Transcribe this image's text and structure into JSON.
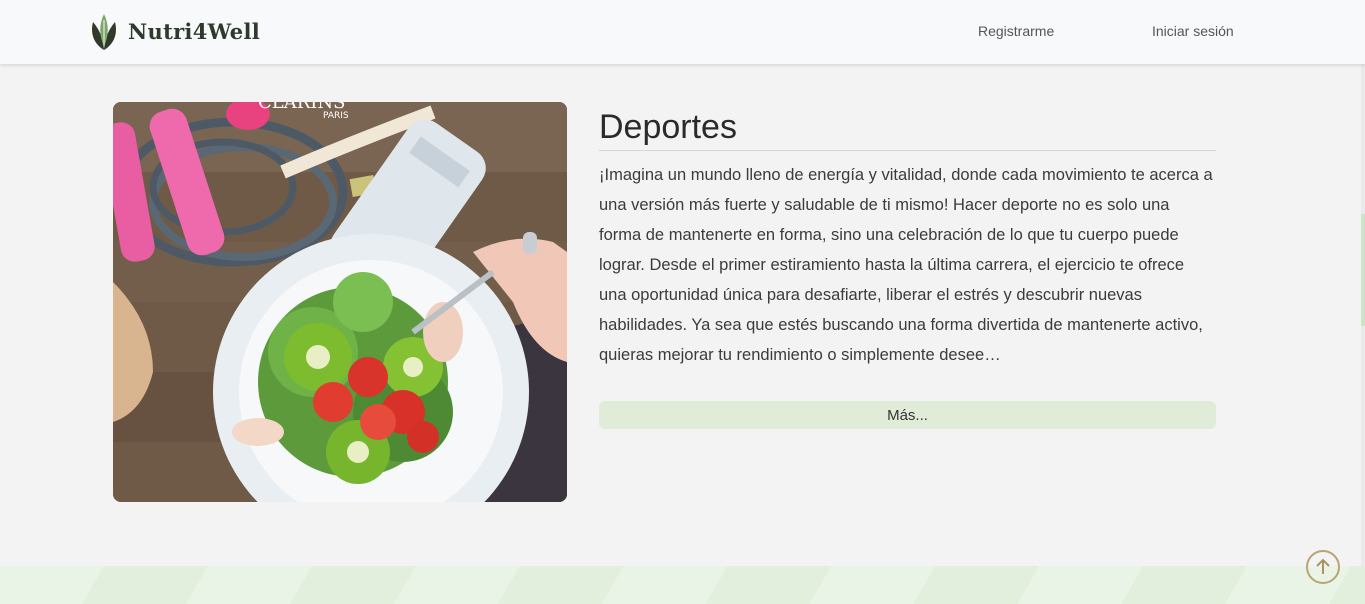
{
  "header": {
    "brand": "Nutri4Well",
    "nav": {
      "register_label": "Registrarme",
      "login_label": "Iniciar sesión"
    }
  },
  "card": {
    "image_alt": "Ensalada de kiwi y fresas con cuerdas de saltar y botella de agua",
    "title": "Deportes",
    "text": "¡Imagina un mundo lleno de energía y vitalidad, donde cada movimiento te acerca a una versión más fuerte y saludable de ti mismo! Hacer deporte no es solo una forma de mantenerte en forma, sino una celebración de lo que tu cuerpo puede lograr. Desde el primer estiramiento hasta la última carrera, el ejercicio te ofrece una oportunidad única para desafiarte, liberar el estrés y descubrir nuevas habilidades. Ya sea que estés buscando una forma divertida de mantenerte activo, quieras mejorar tu rendimiento o simplemente desee…",
    "more_label": "Más..."
  },
  "icons": {
    "logo": "leaf-logo-icon",
    "scroll_top": "arrow-up-circle-icon"
  },
  "colors": {
    "accent_green": "#e1ecd8",
    "header_bg": "#f8f9fa",
    "page_bg": "#f3f3f3",
    "scroll_top_ring": "#b7a574"
  }
}
